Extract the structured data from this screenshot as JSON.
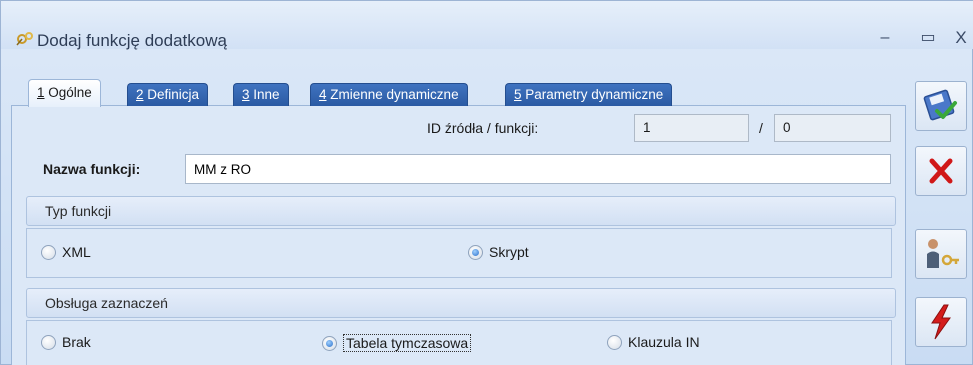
{
  "window": {
    "title": "Dodaj funkcję dodatkową",
    "minimize_label": "–",
    "maximize_label": "▭",
    "close_label": "X"
  },
  "tabs": [
    {
      "num": "1",
      "label": " Ogólne",
      "active": true
    },
    {
      "num": "2",
      "label": " Definicja",
      "active": false
    },
    {
      "num": "3",
      "label": " Inne",
      "active": false
    },
    {
      "num": "4",
      "label": " Zmienne dynamiczne",
      "active": false
    },
    {
      "num": "5",
      "label": " Parametry dynamiczne",
      "active": false
    }
  ],
  "general": {
    "id_label": "ID źródła / funkcji:",
    "id_source": "1",
    "slash": "/",
    "id_function": "0",
    "name_label": "Nazwa funkcji:",
    "name_value": "MM z RO"
  },
  "function_type": {
    "header": "Typ funkcji",
    "options": [
      {
        "label": "XML",
        "selected": false
      },
      {
        "label": "Skrypt",
        "selected": true
      }
    ]
  },
  "selection_handling": {
    "header": "Obsługa zaznaczeń",
    "options": [
      {
        "label": "Brak",
        "selected": false
      },
      {
        "label": "Tabela tymczasowa",
        "selected": true
      },
      {
        "label": "Klauzula IN",
        "selected": false
      }
    ]
  },
  "colors": {
    "tab_blue": "#2b5aa3",
    "panel_bg": "#dce8f7",
    "cancel_red": "#d01818",
    "save_green": "#3aa83a"
  }
}
